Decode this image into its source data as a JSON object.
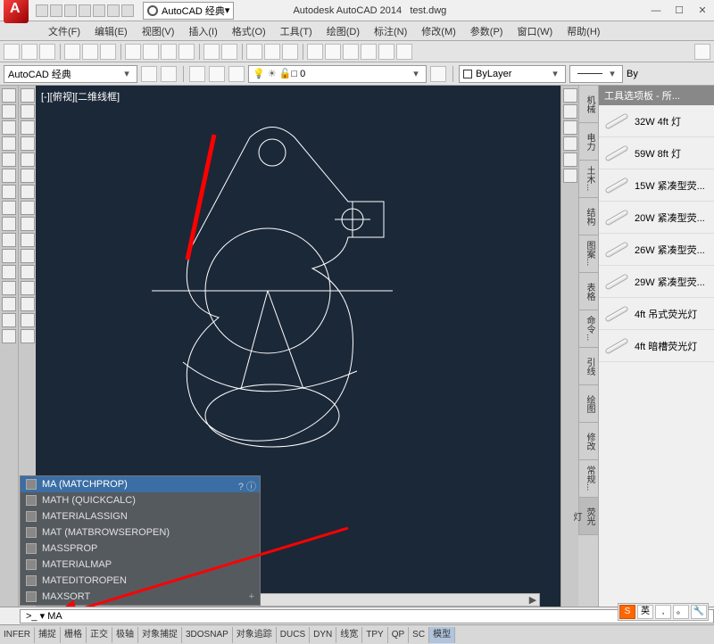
{
  "title": {
    "app": "Autodesk AutoCAD 2014",
    "file": "test.dwg"
  },
  "workspace_selector": "AutoCAD 经典",
  "menus": [
    "文件(F)",
    "编辑(E)",
    "视图(V)",
    "插入(I)",
    "格式(O)",
    "工具(T)",
    "绘图(D)",
    "标注(N)",
    "修改(M)",
    "参数(P)",
    "窗口(W)",
    "帮助(H)"
  ],
  "workspace_row": {
    "name": "AutoCAD 经典"
  },
  "layer_combo": {
    "swatch": "□",
    "name": "0"
  },
  "bylayer": "ByLayer",
  "by_label": "By",
  "view_label": "[-][俯视][二维线框]",
  "command": {
    "prefix": ">_",
    "typed": "MA"
  },
  "autocomplete": [
    {
      "label": "MA (MATCHPROP)",
      "active": true
    },
    {
      "label": "MATH (QUICKCALC)"
    },
    {
      "label": "MATERIALASSIGN"
    },
    {
      "label": "MAT (MATBROWSEROPEN)"
    },
    {
      "label": "MASSPROP"
    },
    {
      "label": "MATERIALMAP"
    },
    {
      "label": "MATEDITOROPEN"
    },
    {
      "label": "MAXSORT"
    }
  ],
  "status": [
    "INFER",
    "捕捉",
    "栅格",
    "正交",
    "极轴",
    "对象捕捉",
    "3DOSNAP",
    "对象追踪",
    "DUCS",
    "DYN",
    "线宽",
    "TPY",
    "QP",
    "SC",
    "模型"
  ],
  "palette": {
    "title": "工具选项板 - 所...",
    "items": [
      "32W 4ft 灯",
      "59W 8ft 灯",
      "15W 紧凑型荧...",
      "20W 紧凑型荧...",
      "26W 紧凑型荧...",
      "29W 紧凑型荧...",
      "4ft 吊式荧光灯",
      "4ft 暗槽荧光灯"
    ]
  },
  "vtabs": [
    "机械",
    "电力",
    "土木...",
    "结构",
    "图案...",
    "表格",
    "命令...",
    "引线",
    "绘图",
    "修改",
    "常规...",
    "荧光灯"
  ],
  "ime": [
    "S",
    "英",
    ",",
    "。",
    "🔧"
  ]
}
